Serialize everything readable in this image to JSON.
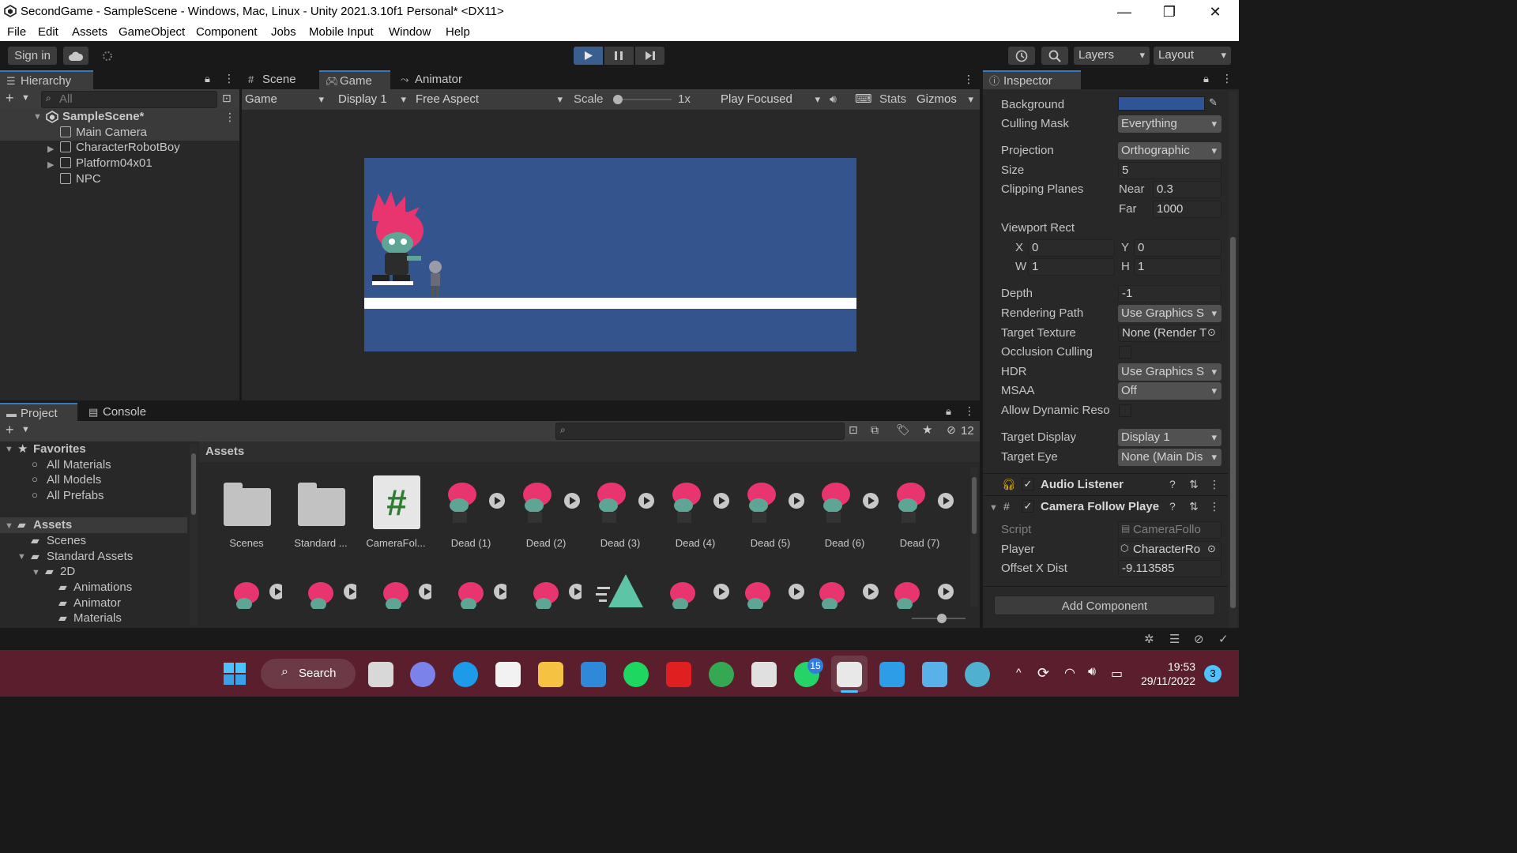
{
  "window": {
    "title": "SecondGame - SampleScene - Windows, Mac, Linux - Unity 2021.3.10f1 Personal* <DX11>",
    "minimize": "—",
    "maximize": "❐",
    "close": "✕"
  },
  "menu": [
    "File",
    "Edit",
    "Assets",
    "GameObject",
    "Component",
    "Jobs",
    "Mobile Input",
    "Window",
    "Help"
  ],
  "toolbar": {
    "sign_in": "Sign in",
    "layers": "Layers",
    "layout": "Layout"
  },
  "hierarchy": {
    "tab": "Hierarchy",
    "search_placeholder": "All",
    "scene": "SampleScene*",
    "items": [
      "Main Camera",
      "CharacterRobotBoy",
      "Platform04x01",
      "NPC"
    ]
  },
  "scene_tabs": [
    "Scene",
    "Game",
    "Animator"
  ],
  "game_bar": {
    "mode": "Game",
    "display": "Display 1",
    "aspect": "Free Aspect",
    "scale_label": "Scale",
    "scale_value": "1x",
    "play_focused": "Play Focused",
    "stats": "Stats",
    "gizmos": "Gizmos"
  },
  "game_view": {
    "sky_color": "#33548c",
    "ground_color": "#ffffff"
  },
  "project": {
    "tabs": [
      "Project",
      "Console"
    ],
    "count": "12",
    "favorites_label": "Favorites",
    "favorites": [
      "All Materials",
      "All Models",
      "All Prefabs"
    ],
    "assets_label": "Assets",
    "tree": [
      "Scenes",
      "Standard Assets",
      "2D",
      "Animations",
      "Animator",
      "Materials"
    ],
    "breadcrumb": "Assets",
    "row1": [
      "Scenes",
      "Standard ...",
      "CameraFol...",
      "Dead (1)",
      "Dead (2)",
      "Dead (3)",
      "Dead (4)",
      "Dead (5)",
      "Dead (6)",
      "Dead (7)"
    ]
  },
  "inspector": {
    "tab": "Inspector",
    "camera": {
      "background_label": "Background",
      "background_color": "#2f5597",
      "culling_mask_label": "Culling Mask",
      "culling_mask": "Everything",
      "projection_label": "Projection",
      "projection": "Orthographic",
      "size_label": "Size",
      "size": "5",
      "clipping_label": "Clipping Planes",
      "near_label": "Near",
      "near": "0.3",
      "far_label": "Far",
      "far": "1000",
      "viewport_label": "Viewport Rect",
      "x_label": "X",
      "x": "0",
      "y_label": "Y",
      "y": "0",
      "w_label": "W",
      "w": "1",
      "h_label": "H",
      "h": "1",
      "depth_label": "Depth",
      "depth": "-1",
      "rendering_path_label": "Rendering Path",
      "rendering_path": "Use Graphics S",
      "target_texture_label": "Target Texture",
      "target_texture": "None (Render T",
      "occlusion_label": "Occlusion Culling",
      "hdr_label": "HDR",
      "hdr": "Use Graphics S",
      "msaa_label": "MSAA",
      "msaa": "Off",
      "dynamic_res_label": "Allow Dynamic Reso",
      "target_display_label": "Target Display",
      "target_display": "Display 1",
      "target_eye_label": "Target Eye",
      "target_eye": "None (Main Dis"
    },
    "audio_listener": "Audio Listener",
    "camera_follow": {
      "title": "Camera Follow Playe",
      "script_label": "Script",
      "script": "CameraFollo",
      "player_label": "Player",
      "player": "CharacterRo",
      "offset_label": "Offset X Dist",
      "offset": "-9.113585"
    },
    "add_component": "Add Component"
  },
  "taskbar": {
    "search": "Search",
    "time": "19:53",
    "date": "29/11/2022",
    "whatsapp_badge": "15",
    "notif_count": "3"
  }
}
